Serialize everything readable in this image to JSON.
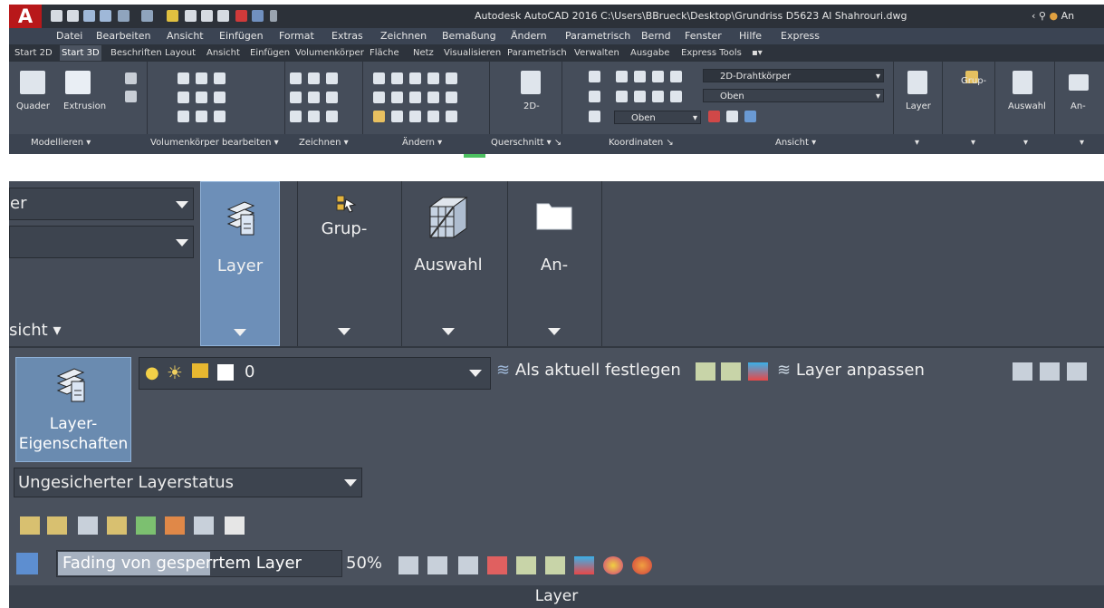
{
  "window": {
    "app_logo": "A",
    "title": "Autodesk AutoCAD 2016    C:\\Users\\BBrueck\\Desktop\\Grundriss D5623 Al Shahrouri.dwg",
    "user_short": "An"
  },
  "menubar": [
    "Datei",
    "Bearbeiten",
    "Ansicht",
    "Einfügen",
    "Format",
    "Extras",
    "Zeichnen",
    "Bemaßung",
    "Ändern",
    "Parametrisch",
    "Bernd",
    "Fenster",
    "Hilfe",
    "Express"
  ],
  "ribbon_tabs": [
    "Start 2D",
    "Start 3D",
    "Beschriften",
    "Layout",
    "Ansicht",
    "Einfügen",
    "Volumenkörper",
    "Fläche",
    "Netz",
    "Visualisieren",
    "Parametrisch",
    "Verwalten",
    "Ausgabe",
    "Express Tools"
  ],
  "ribbon_active_tab": "Start 3D",
  "ribbon": {
    "quader": "Quader",
    "extrusion": "Extrusion",
    "querschnitt_btn": "2D-",
    "visual_style": "2D-Drahtkörper",
    "view_top": "Oben",
    "ucs_view": "Oben",
    "layer": "Layer",
    "grup": "Grup-",
    "auswahl": "Auswahl",
    "an": "An-",
    "panels": [
      "Modellieren",
      "Volumenkörper bearbeiten",
      "Zeichnen",
      "Ändern",
      "Querschnitt",
      "Koordinaten",
      "Ansicht"
    ]
  },
  "zoom": {
    "combo1_text": "er",
    "ansicht_label": "sicht",
    "buttons": {
      "layer": "Layer",
      "grup": "Grup-",
      "auswahl": "Auswahl",
      "an": "An-"
    },
    "layer_panel": {
      "layer_props_label_1": "Layer-",
      "layer_props_label_2": "Eigenschaften",
      "current_layer": "0",
      "set_current": "Als aktuell festlegen",
      "match_layer": "Layer anpassen",
      "layer_state": "Ungesicherter Layerstatus",
      "fade_text": "Fading von gesperrtem Layer",
      "fade_pct": "50%",
      "footer": "Layer"
    }
  },
  "colors": {
    "accent": "#6a8bb0",
    "logo_red": "#b8181a",
    "title_bg": "#2c3139",
    "panel_bg": "#4a515d"
  }
}
